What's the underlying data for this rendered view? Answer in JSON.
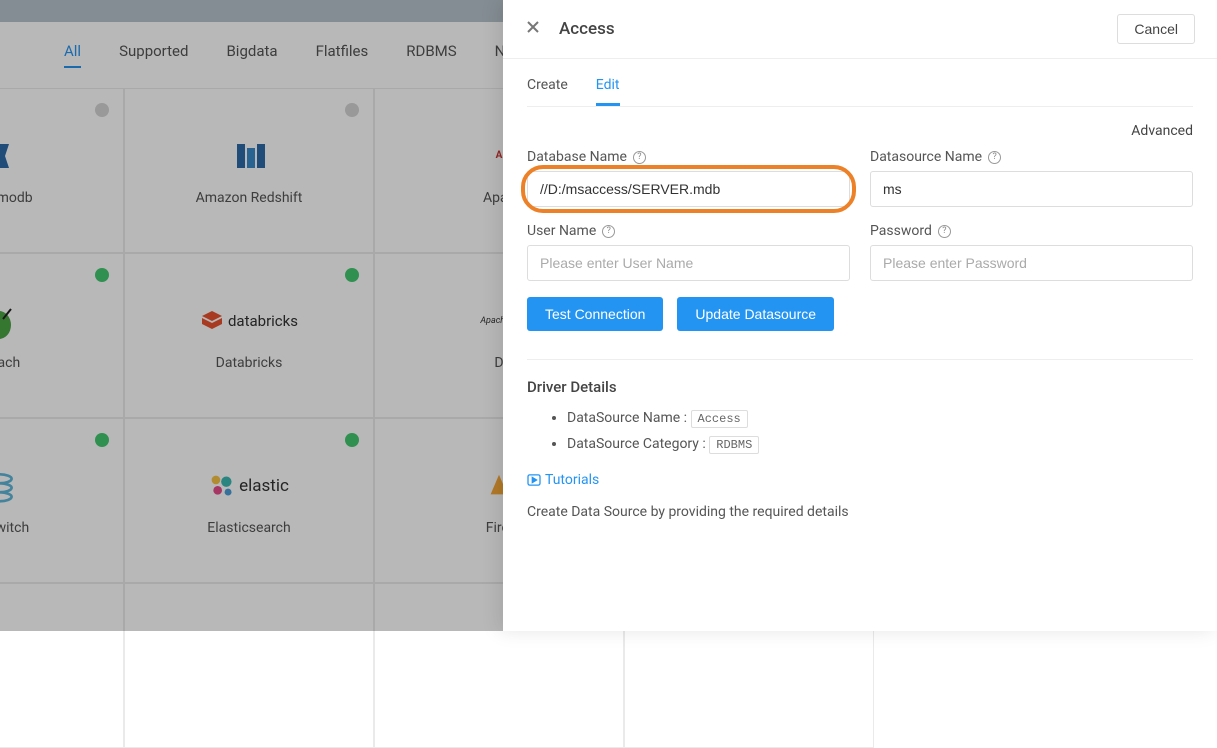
{
  "tabs": [
    "All",
    "Supported",
    "Bigdata",
    "Flatfiles",
    "RDBMS",
    "N"
  ],
  "activeTabIndex": 0,
  "cards": [
    {
      "name": "Dynamodb",
      "badge": "grey"
    },
    {
      "name": "Amazon Redshift",
      "badge": "grey"
    },
    {
      "name": "Apac",
      "badge": ""
    },
    {
      "name": "",
      "badge": ""
    },
    {
      "name": "kroach",
      "badge": "green"
    },
    {
      "name": "Databricks",
      "badge": "green"
    },
    {
      "name": "D",
      "badge": ""
    },
    {
      "name": "",
      "badge": ""
    },
    {
      "name": "nicSwitch",
      "badge": "green"
    },
    {
      "name": "Elasticsearch",
      "badge": "green"
    },
    {
      "name": "Firel",
      "badge": ""
    },
    {
      "name": "",
      "badge": ""
    }
  ],
  "panel": {
    "title": "Access",
    "cancel": "Cancel",
    "subtabs": [
      "Create",
      "Edit"
    ],
    "activeSubtabIndex": 1,
    "advanced": "Advanced",
    "fields": {
      "dbname": {
        "label": "Database Name",
        "value": "//D:/msaccess/SERVER.mdb",
        "placeholder": ""
      },
      "dsname": {
        "label": "Datasource Name",
        "value": "ms",
        "placeholder": ""
      },
      "username": {
        "label": "User Name",
        "value": "",
        "placeholder": "Please enter User Name"
      },
      "password": {
        "label": "Password",
        "value": "",
        "placeholder": "Please enter Password"
      }
    },
    "buttons": {
      "test": "Test Connection",
      "update": "Update Datasource"
    },
    "driver": {
      "heading": "Driver Details",
      "nameLabel": "DataSource Name :",
      "nameValue": "Access",
      "catLabel": "DataSource Category :",
      "catValue": "RDBMS"
    },
    "tutorials": "Tutorials",
    "helptext": "Create Data Source by providing the required details"
  }
}
